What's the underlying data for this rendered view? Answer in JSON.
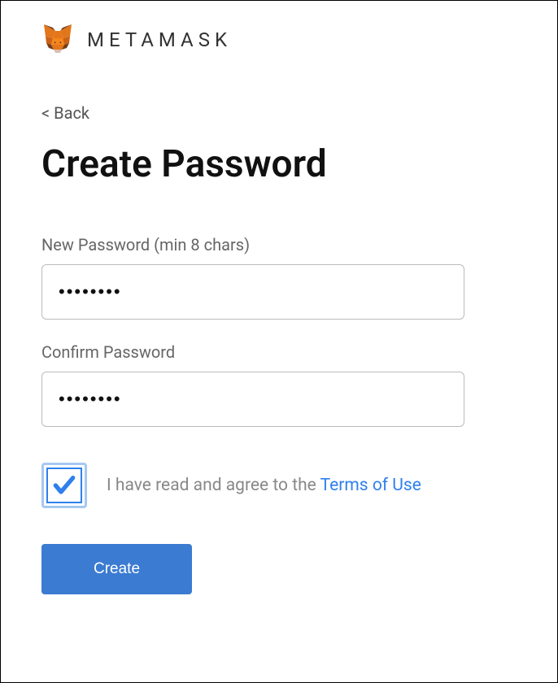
{
  "header": {
    "brand": "METAMASK"
  },
  "nav": {
    "back": "< Back"
  },
  "page": {
    "title": "Create Password"
  },
  "form": {
    "new_password": {
      "label": "New Password (min 8 chars)",
      "value": "••••••••"
    },
    "confirm_password": {
      "label": "Confirm Password",
      "value": "••••••••"
    },
    "tos": {
      "text": "I have read and agree to the ",
      "link": "Terms of Use",
      "checked": true
    },
    "submit_label": "Create"
  }
}
